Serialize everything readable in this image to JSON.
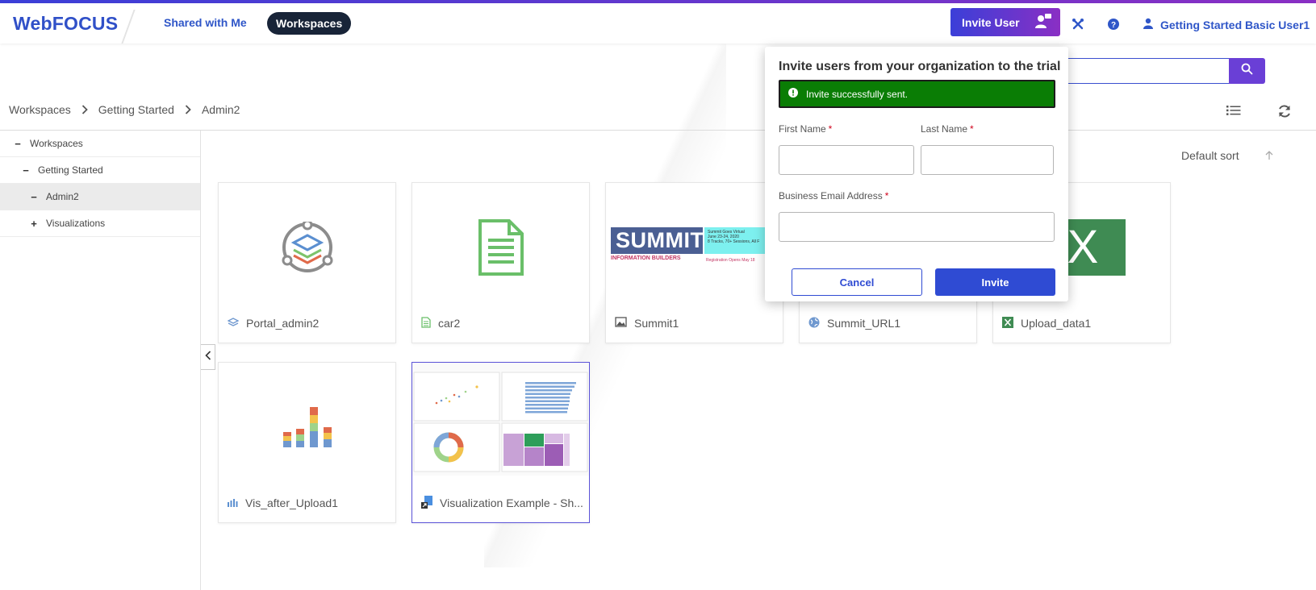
{
  "header": {
    "logo": "WebFOCUS",
    "nav": {
      "shared": "Shared with Me",
      "workspaces": "Workspaces"
    },
    "invite_user": "Invite User",
    "user_name": "Getting Started Basic User1",
    "accent_gradient": [
      "#3b3fd8",
      "#8a2fc4"
    ]
  },
  "breadcrumb": [
    "Workspaces",
    "Getting Started",
    "Admin2"
  ],
  "sidebar": {
    "items": [
      {
        "toggle": "−",
        "label": "Workspaces"
      },
      {
        "toggle": "−",
        "label": "Getting Started"
      },
      {
        "toggle": "−",
        "label": "Admin2"
      },
      {
        "toggle": "+",
        "label": "Visualizations"
      }
    ]
  },
  "sort": {
    "label": "Default sort"
  },
  "tiles": [
    {
      "name": "Portal_admin2",
      "type_icon": "portal-icon"
    },
    {
      "name": "car2",
      "type_icon": "document-icon"
    },
    {
      "name": "Summit1",
      "type_icon": "image-icon",
      "banner": {
        "logo": "SUMMIT",
        "sub": "INFORMATION BUILDERS",
        "line1": "Summit Goes Virtual",
        "line2": "June 23-24, 2020",
        "line3": "8 Tracks, 70+ Sessions, All F",
        "reg": "Registration Opens May 18"
      }
    },
    {
      "name": "Summit_URL1",
      "type_icon": "globe-icon"
    },
    {
      "name": "Upload_data1",
      "type_icon": "excel-icon",
      "thumb_letter": "X"
    },
    {
      "name": "Vis_after_Upload1",
      "type_icon": "bar-chart-icon"
    },
    {
      "name": "Visualization Example - Sh...",
      "type_icon": "shortcut-icon"
    }
  ],
  "modal": {
    "title": "Invite users from your organization to the trial",
    "alert": "Invite successfully sent.",
    "first_name_label": "First Name",
    "last_name_label": "Last Name",
    "email_label": "Business Email Address",
    "required_mark": "*",
    "first_name_value": "",
    "last_name_value": "",
    "email_value": "",
    "cancel": "Cancel",
    "invite": "Invite",
    "success_color": "#0a7d05",
    "primary_color": "#2f4bd3"
  }
}
